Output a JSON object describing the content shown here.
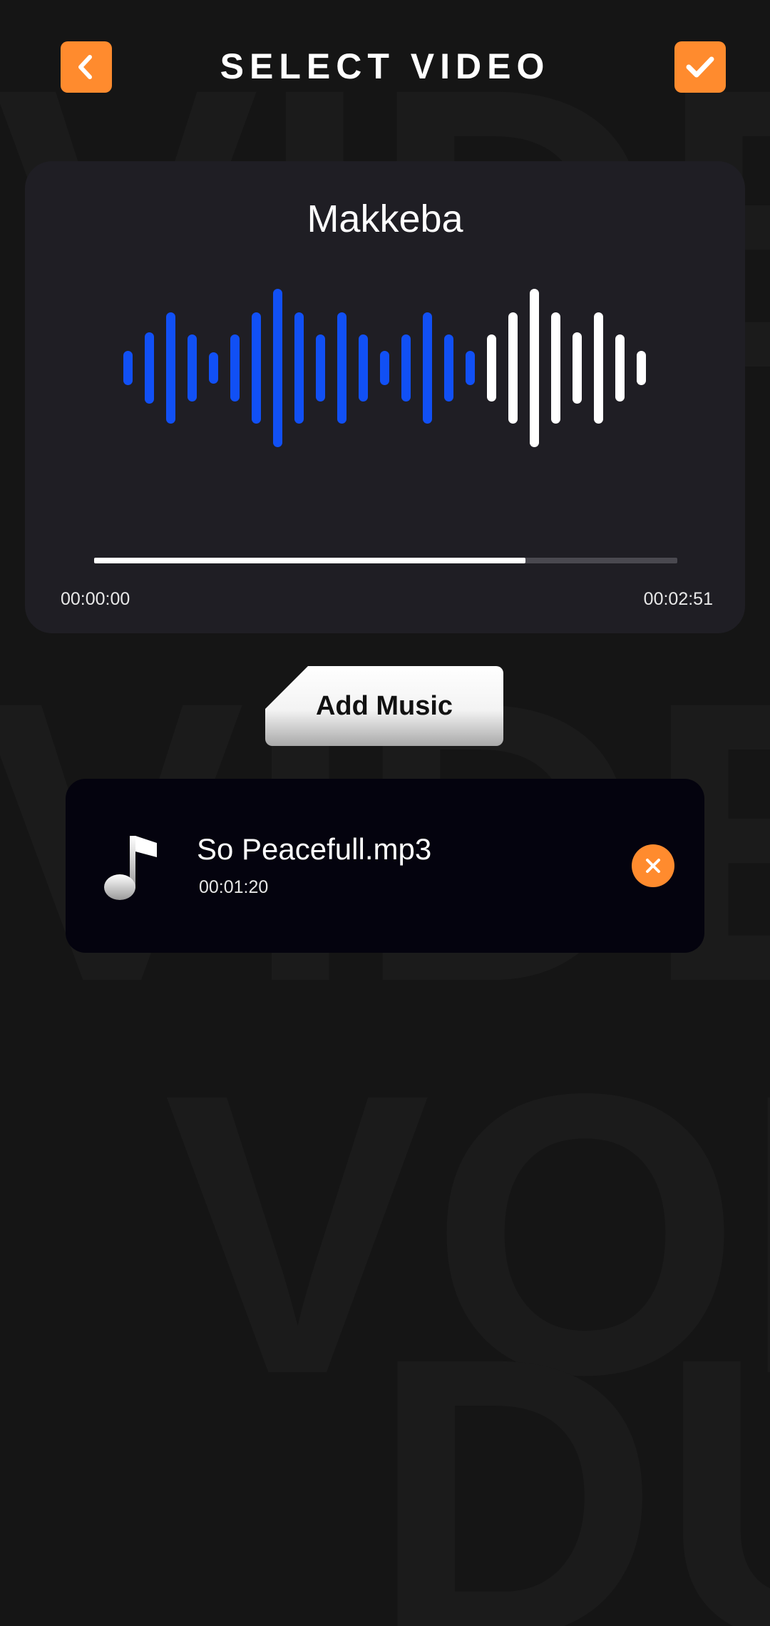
{
  "header": {
    "title": "SELECT VIDEO",
    "accent_color": "#ff8b2e",
    "back_icon": "chevron-left-icon",
    "done_icon": "checkmark-icon"
  },
  "background": {
    "watermark_lines": [
      "VIDEO",
      "DUB",
      "VIDEO",
      "VOIC",
      "DUB"
    ]
  },
  "player": {
    "song_title": "Makkeba",
    "time_start": "00:00:00",
    "time_end": "00:02:51",
    "progress": 0.74,
    "played_color": "#1150f5",
    "unplayed_color": "#ffffff",
    "waveform_levels": [
      0.22,
      0.45,
      0.7,
      0.42,
      0.2,
      0.42,
      0.7,
      1.0,
      0.7,
      0.42,
      0.7,
      0.42,
      0.22,
      0.42,
      0.7,
      0.42,
      0.22,
      0.42,
      0.7,
      1.0,
      0.7,
      0.45,
      0.7,
      0.42,
      0.22
    ]
  },
  "add_music": {
    "label": "Add Music"
  },
  "music_item": {
    "icon": "music-note-icon",
    "name": "So Peacefull.mp3",
    "duration": "00:01:20",
    "remove_icon": "close-icon"
  }
}
